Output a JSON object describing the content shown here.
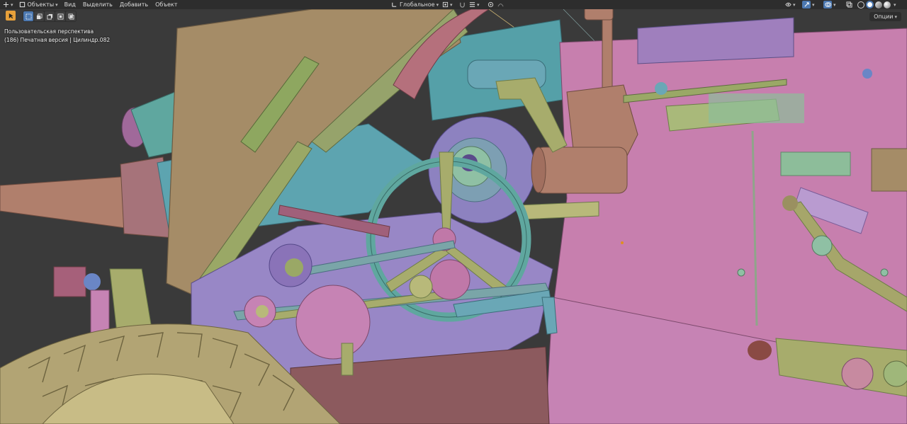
{
  "header": {
    "mode_label": "Объекты",
    "menus": [
      "Вид",
      "Выделить",
      "Добавить",
      "Объект"
    ],
    "transform_orientation": "Глобальное"
  },
  "options_label": "Опции",
  "viewport": {
    "view_name": "Пользовательская перспектива",
    "object_info": "(186) Печатная версия | Цилиндр.082"
  },
  "icons": [
    "transform-icon",
    "object-mode-icon",
    "select-box-icon",
    "pivot-icon",
    "snap-icon",
    "proportional-icon",
    "visibility-icon",
    "gizmo-icon",
    "overlay-icon",
    "xray-icon",
    "shading-wireframe-icon",
    "shading-solid-icon",
    "shading-material-icon",
    "shading-rendered-icon"
  ],
  "colors": {
    "header_bg": "#2d2d2d",
    "viewport_bg": "#3a3a3a",
    "active_tool": "#e8a13a",
    "selected_mode": "#4c78b0",
    "pink": "#c77fae",
    "purple": "#9887c6",
    "teal": "#5fa79f",
    "olive": "#a7ac6c",
    "tan": "#a58c67",
    "copper": "#b07f6c"
  }
}
